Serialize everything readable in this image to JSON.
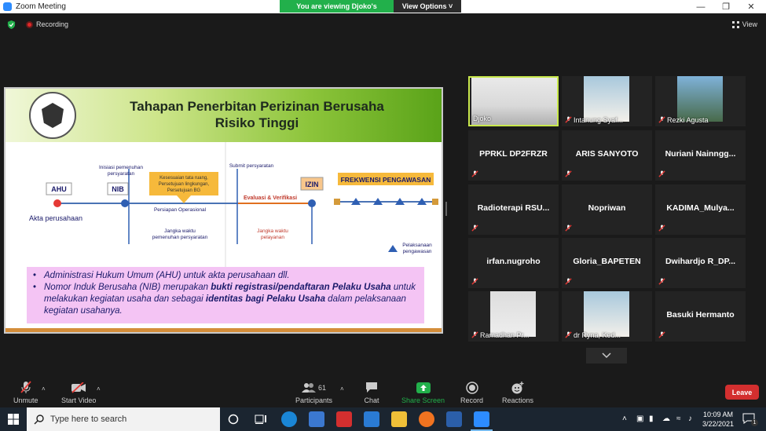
{
  "window": {
    "title": "Zoom Meeting",
    "viewing_message": "You are viewing Djoko's screen",
    "view_options": "View Options"
  },
  "meeting": {
    "recording_label": "Recording",
    "view_label": "View"
  },
  "slide": {
    "title_line1": "Tahapan Penerbitan Perizinan Berusaha",
    "title_line2": "Risiko Tinggi",
    "diagram": {
      "ahu": "AHU",
      "nib": "NIB",
      "izin": "IZIN",
      "inisiasi": [
        "Inisiasi pemenuhan",
        "persyaratan"
      ],
      "kesesuaian": [
        "Kesesuaian tata ruang,",
        "Persetujuan lingkungan,",
        "Persetujuan BG"
      ],
      "persiapan": "Persiapan Operasional",
      "submit": "Submit persyaratan",
      "evaluasi": "Evaluasi & Verifikasi",
      "frekwensi": "FREKWENSI PENGAWASAN",
      "akta": "Akta perusahaan",
      "jangka_pemenuhan": [
        "Jangka waktu",
        "pemenuhan persyaratan"
      ],
      "jangka_pelayanan": [
        "Jangka waktu",
        "pelayanan"
      ],
      "pelaksanaan": [
        "Pelaksanaan",
        "pengawasan"
      ]
    },
    "bullets": {
      "b1": "Administrasi Hukum Umum (AHU) untuk akta perusahaan dll.",
      "b2_a": "Nomor Induk Berusaha (NIB) merupakan ",
      "b2_b": "bukti registrasi/pendaftaran Pelaku Usaha",
      "b2_c": " untuk melakukan kegiatan usaha dan sebagai ",
      "b2_d": "identitas bagi Pelaku Usaha",
      "b2_e": " dalam pelaksanaan kegiatan usahanya."
    }
  },
  "participants": [
    {
      "name": "Djoko",
      "type": "video",
      "active": true
    },
    {
      "name": "Intanung Syaf...",
      "type": "video"
    },
    {
      "name": "Rezki Agusta",
      "type": "video"
    },
    {
      "name": "PPRKL DP2FRZR",
      "type": "name"
    },
    {
      "name": "ARIS SANYOTO",
      "type": "name"
    },
    {
      "name": "Nuriani Nainngg...",
      "type": "name"
    },
    {
      "name": "Radioterapi RSU...",
      "type": "name"
    },
    {
      "name": "Nopriwan",
      "type": "name"
    },
    {
      "name": "KADIMA_Mulya...",
      "type": "name"
    },
    {
      "name": "irfan.nugroho",
      "type": "name"
    },
    {
      "name": "Gloria_BAPETEN",
      "type": "name"
    },
    {
      "name": "Dwihardjo R_DP...",
      "type": "name"
    },
    {
      "name": "Ramadhan Pr...",
      "type": "video"
    },
    {
      "name": "dr Ryna, Ked...",
      "type": "video"
    },
    {
      "name": "Basuki Hermanto",
      "type": "name"
    }
  ],
  "toolbar": {
    "unmute": "Unmute",
    "start_video": "Start Video",
    "participants_count": "61",
    "participants": "Participants",
    "chat": "Chat",
    "share_screen": "Share Screen",
    "record": "Record",
    "reactions": "Reactions",
    "leave": "Leave"
  },
  "taskbar": {
    "search_placeholder": "Type here to search",
    "time": "10:09 AM",
    "date": "3/22/2021",
    "notification_count": "1"
  },
  "colors": {
    "zoom_blue": "#2d8cff",
    "viewing_green": "#22b04b",
    "active_speaker": "#c8e84c",
    "leave_red": "#d32f2f",
    "share_green": "#22b04b"
  }
}
